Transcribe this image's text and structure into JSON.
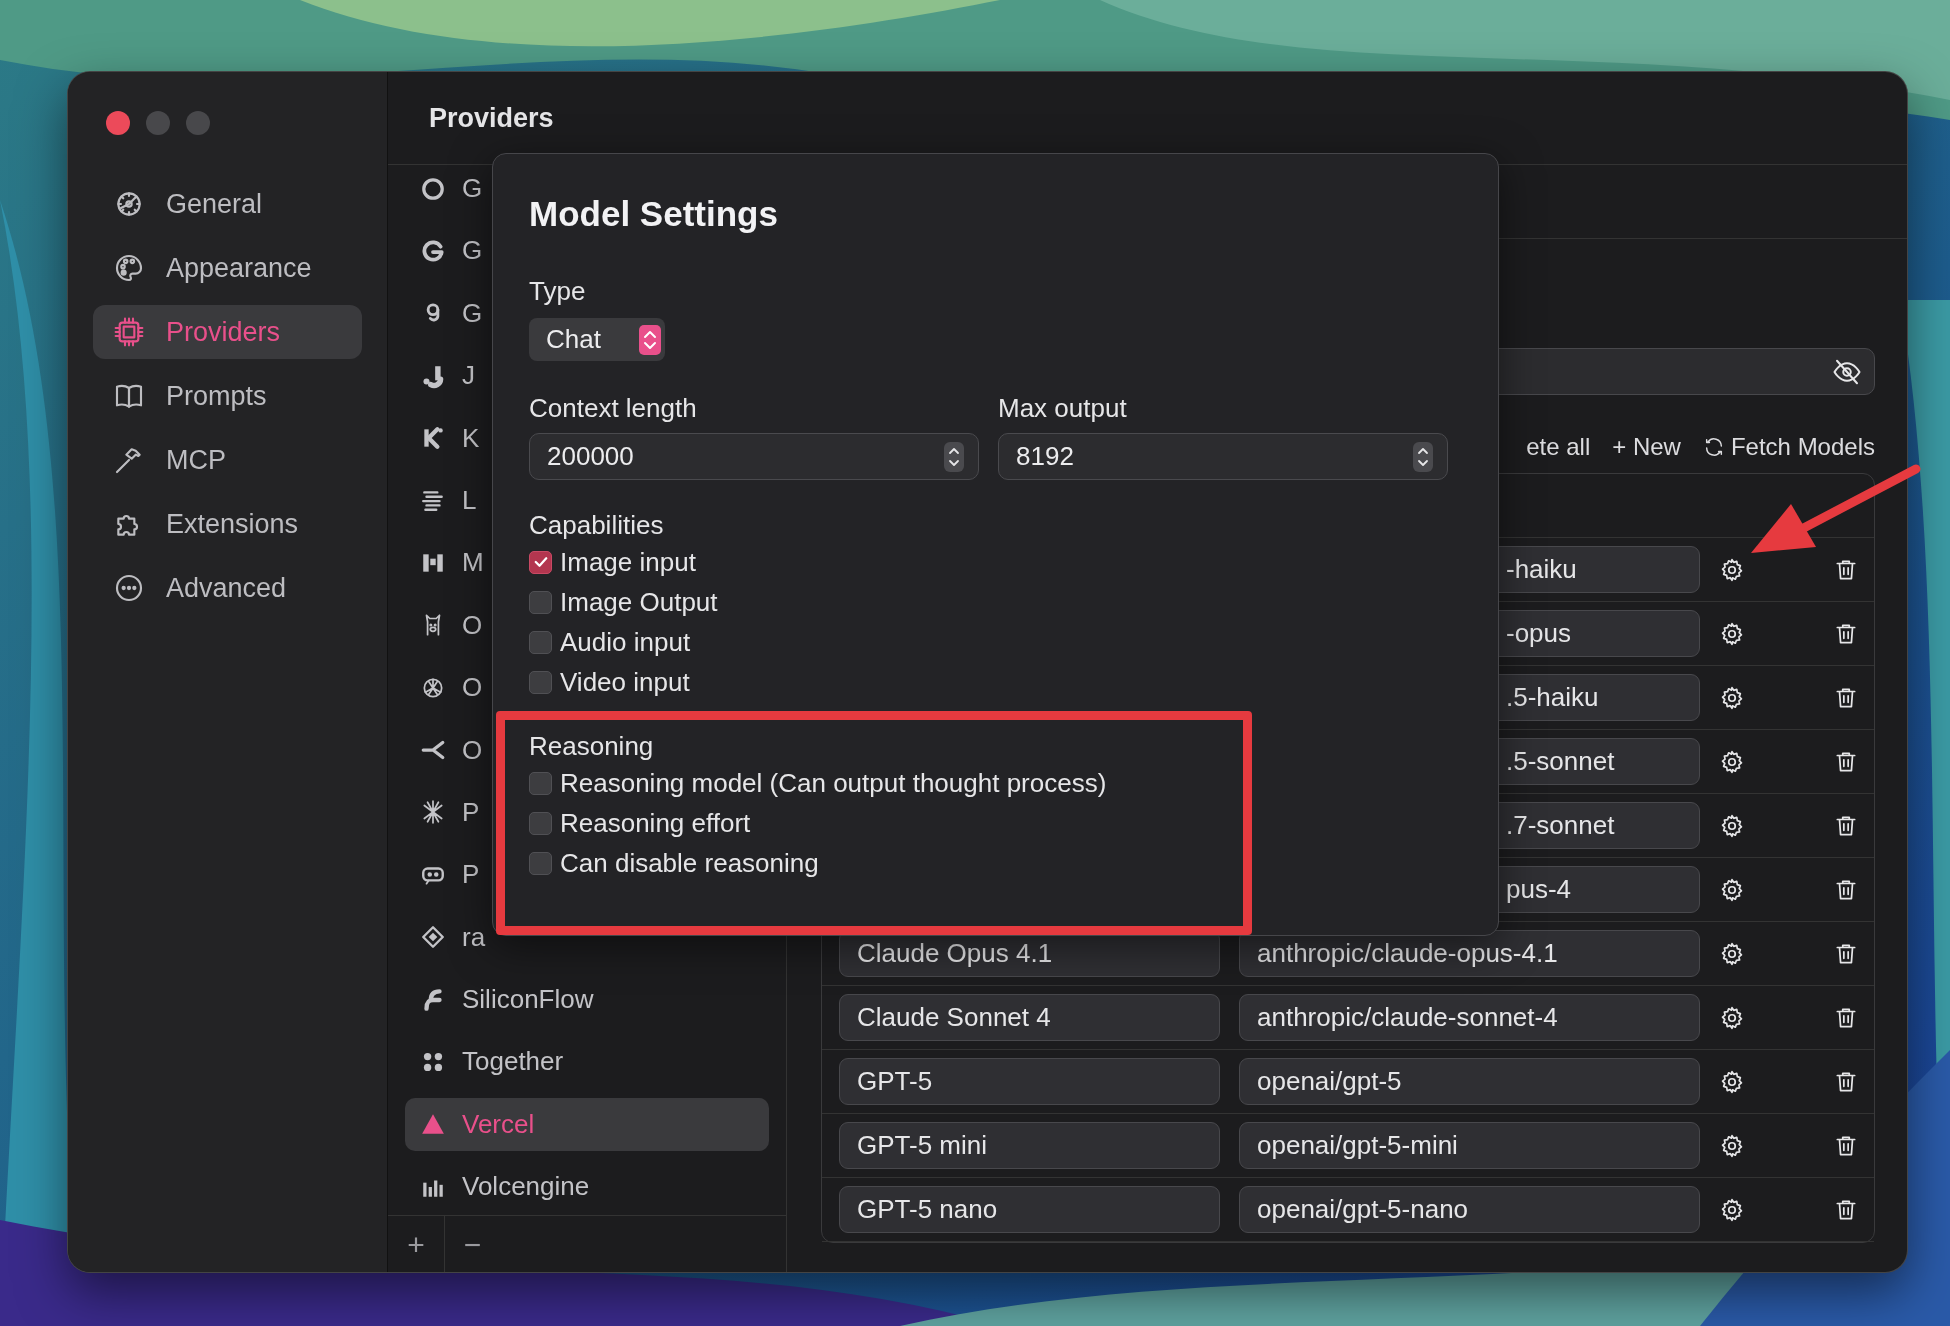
{
  "window": {
    "title": "Providers"
  },
  "sidebar": {
    "items": [
      {
        "label": "General",
        "selected": false
      },
      {
        "label": "Appearance",
        "selected": false
      },
      {
        "label": "Providers",
        "selected": true
      },
      {
        "label": "Prompts",
        "selected": false
      },
      {
        "label": "MCP",
        "selected": false
      },
      {
        "label": "Extensions",
        "selected": false
      },
      {
        "label": "Advanced",
        "selected": false
      }
    ]
  },
  "providers": {
    "items": [
      {
        "label": "G",
        "selected": false
      },
      {
        "label": "G",
        "selected": false
      },
      {
        "label": "G",
        "selected": false
      },
      {
        "label": "J",
        "selected": false
      },
      {
        "label": "K",
        "selected": false
      },
      {
        "label": "L",
        "selected": false
      },
      {
        "label": "M",
        "selected": false
      },
      {
        "label": "O",
        "selected": false
      },
      {
        "label": "O",
        "selected": false
      },
      {
        "label": "O",
        "selected": false
      },
      {
        "label": "P",
        "selected": false
      },
      {
        "label": "P",
        "selected": false
      },
      {
        "label": "ra",
        "selected": false
      },
      {
        "label": "SiliconFlow",
        "selected": false
      },
      {
        "label": "Together",
        "selected": false
      },
      {
        "label": "Vercel",
        "selected": true
      },
      {
        "label": "Volcengine",
        "selected": false
      }
    ],
    "add_button": "+",
    "remove_button": "−"
  },
  "models": {
    "actions": [
      {
        "label": "ete all",
        "kind": "text"
      },
      {
        "label": "+ New",
        "kind": "text"
      },
      {
        "label": "Fetch Models",
        "kind": "refresh"
      }
    ],
    "rows": [
      {
        "id": "-haiku"
      },
      {
        "id": "-opus"
      },
      {
        "id": ".5-haiku"
      },
      {
        "id": ".5-sonnet"
      },
      {
        "id": ".7-sonnet"
      },
      {
        "id": "pus-4"
      },
      {
        "name": "Claude Opus 4.1",
        "id": "anthropic/claude-opus-4.1"
      },
      {
        "name": "Claude Sonnet 4",
        "id": "anthropic/claude-sonnet-4"
      },
      {
        "name": "GPT-5",
        "id": "openai/gpt-5"
      },
      {
        "name": "GPT-5 mini",
        "id": "openai/gpt-5-mini"
      },
      {
        "name": "GPT-5 nano",
        "id": "openai/gpt-5-nano"
      }
    ]
  },
  "dialog": {
    "title": "Model Settings",
    "type": {
      "label": "Type",
      "value": "Chat"
    },
    "context_length": {
      "label": "Context length",
      "value": "200000"
    },
    "max_output": {
      "label": "Max output",
      "value": "8192"
    },
    "capabilities": {
      "title": "Capabilities",
      "items": [
        {
          "label": "Image input",
          "checked": true
        },
        {
          "label": "Image Output",
          "checked": false
        },
        {
          "label": "Audio input",
          "checked": false
        },
        {
          "label": "Video input",
          "checked": false
        }
      ]
    },
    "reasoning": {
      "title": "Reasoning",
      "items": [
        {
          "label": "Reasoning model (Can output thought process)",
          "checked": false
        },
        {
          "label": "Reasoning effort",
          "checked": false
        },
        {
          "label": "Can disable reasoning",
          "checked": false
        }
      ]
    }
  }
}
